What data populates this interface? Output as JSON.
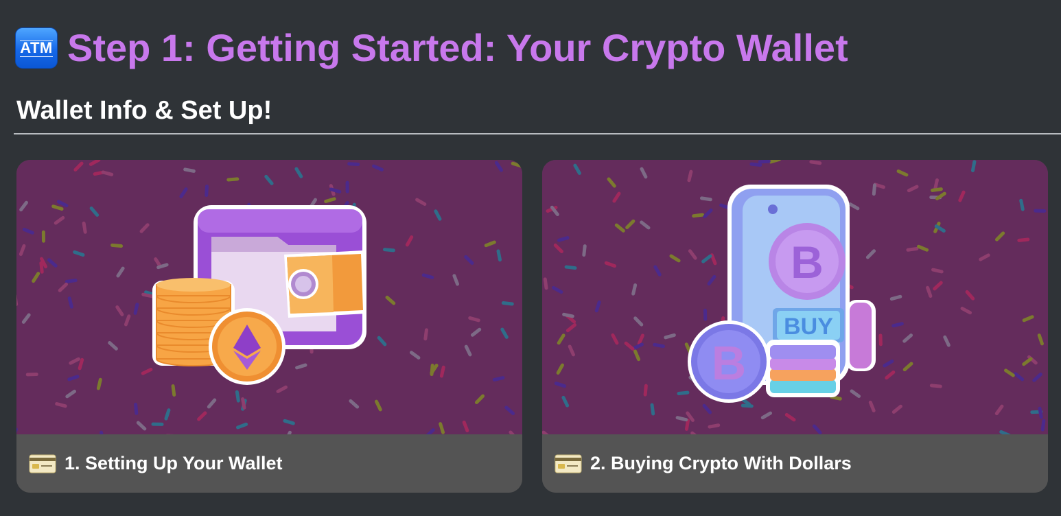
{
  "header": {
    "icon": "atm-sign-icon",
    "icon_text": "ATM",
    "title": "Step 1: Getting Started: Your Crypto Wallet"
  },
  "section": {
    "heading": "Wallet Info & Set Up!"
  },
  "cards": [
    {
      "icon": "credit-card-icon",
      "label": "1. Setting Up Your Wallet",
      "illustration": "wallet-with-ethereum-coins"
    },
    {
      "icon": "credit-card-icon",
      "label": "2. Buying Crypto With Dollars",
      "illustration": "phone-with-bitcoin-buy",
      "illustration_text": "BUY"
    }
  ],
  "colors": {
    "background": "#2f3337",
    "title": "#c878ec",
    "card_footer": "#545454",
    "card_image_bg": "#642c5c"
  }
}
